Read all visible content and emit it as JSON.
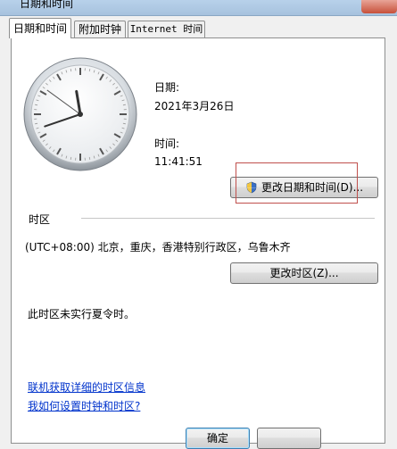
{
  "window": {
    "title": "日期和时间"
  },
  "tabs": [
    {
      "label": "日期和时间"
    },
    {
      "label": "附加时钟"
    },
    {
      "label": "Internet 时间"
    }
  ],
  "date": {
    "label": "日期:",
    "value": "2021年3月26日"
  },
  "time": {
    "label": "时间:",
    "value": "11:41:51"
  },
  "clock": {
    "hour": 11,
    "minute": 41,
    "second": 51
  },
  "buttons": {
    "change_datetime": "更改日期和时间(D)...",
    "change_timezone": "更改时区(Z)...",
    "ok": "确定"
  },
  "timezone": {
    "section_label": "时区",
    "value": "(UTC+08:00) 北京，重庆，香港特别行政区，乌鲁木齐",
    "dst_note": "此时区未实行夏令时。"
  },
  "links": {
    "online_tz_info": "联机获取详细的时区信息",
    "how_to_set": "我如何设置时钟和时区?"
  },
  "colors": {
    "highlight_box": "#c0504d",
    "link": "#0033cc"
  }
}
